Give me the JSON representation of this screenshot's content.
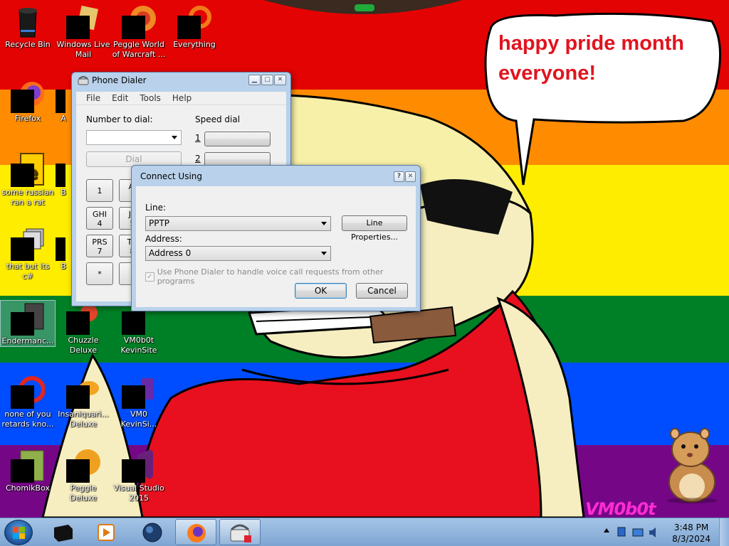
{
  "speech_bubble": {
    "line1": "happy pride month",
    "line2": "everyone!"
  },
  "wallpaper_watermark": "VM0b0t",
  "desktop_icons": [
    {
      "label": "Recycle Bin"
    },
    {
      "label": "Windows Live\nMail"
    },
    {
      "label": "Peggle World\nof Warcraft ..."
    },
    {
      "label": "Everything"
    },
    {
      "label": "Firefox"
    },
    {
      "label": "A"
    },
    {
      "label": "some russian\nran a rat"
    },
    {
      "label": "B"
    },
    {
      "label": "that but its c#"
    },
    {
      "label": "B"
    },
    {
      "label": "Endermanc..."
    },
    {
      "label": "Chuzzle\nDeluxe"
    },
    {
      "label": "VM0b0t\nKevinSite"
    },
    {
      "label": "none of you\nretards kno..."
    },
    {
      "label": "Insaniquari...\nDeluxe"
    },
    {
      "label": "VM0\nKevinSi..."
    },
    {
      "label": "ChomikBox"
    },
    {
      "label": "Peggle Deluxe"
    },
    {
      "label": "Visual Studio\n2015"
    }
  ],
  "phone_dialer": {
    "title": "Phone Dialer",
    "menu": [
      "File",
      "Edit",
      "Tools",
      "Help"
    ],
    "number_label": "Number to dial:",
    "number_value": "",
    "dial_button": "Dial",
    "speed_dial_label": "Speed dial",
    "speed_dial_numbers": [
      "1",
      "2"
    ],
    "keypad": [
      {
        "main": "1",
        "sub": ""
      },
      {
        "main": "AI",
        "sub": ""
      },
      {
        "main": "GHI",
        "sub": "4"
      },
      {
        "main": "JK",
        "sub": "5"
      },
      {
        "main": "PRS",
        "sub": "7"
      },
      {
        "main": "TU",
        "sub": "8"
      },
      {
        "main": "*",
        "sub": ""
      }
    ]
  },
  "connect_dialog": {
    "title": "Connect Using",
    "help_glyph": "?",
    "close_glyph": "✕",
    "line_label": "Line:",
    "line_value": "PPTP",
    "line_properties_button": "Line Properties...",
    "address_label": "Address:",
    "address_value": "Address 0",
    "checkbox_label": "Use Phone Dialer to handle voice call requests from other programs",
    "checkbox_checked": true,
    "ok_button": "OK",
    "cancel_button": "Cancel"
  },
  "taskbar": {
    "clock_time": "3:48 PM",
    "clock_date": "8/3/2024"
  }
}
